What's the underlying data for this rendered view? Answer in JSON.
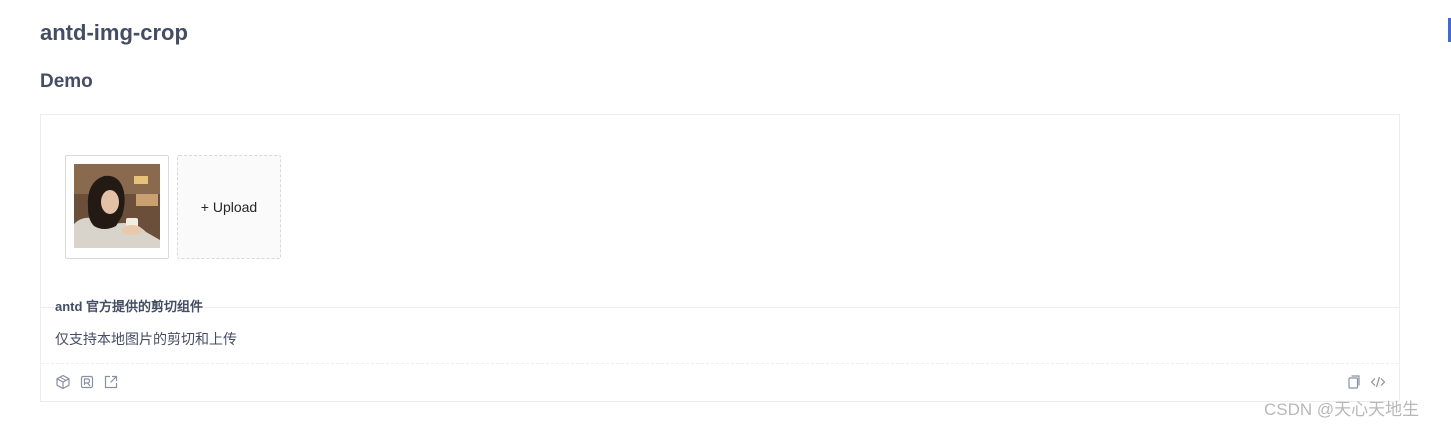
{
  "page": {
    "title": "antd-img-crop",
    "section_title": "Demo"
  },
  "demo": {
    "upload_button_label": "+ Upload",
    "description_title": "antd 官方提供的剪切组件",
    "description_text": "仅支持本地图片的剪切和上传",
    "left_actions": [
      "codesandbox-icon",
      "codepen-icon",
      "open-in-new-window-icon"
    ],
    "right_actions": [
      "copy-icon",
      "show-code-icon"
    ]
  },
  "watermark": {
    "text": "CSDN @天心天地生"
  },
  "colors": {
    "text": "#454d64",
    "border": "#ebedf1",
    "accent": "#4569d4"
  }
}
